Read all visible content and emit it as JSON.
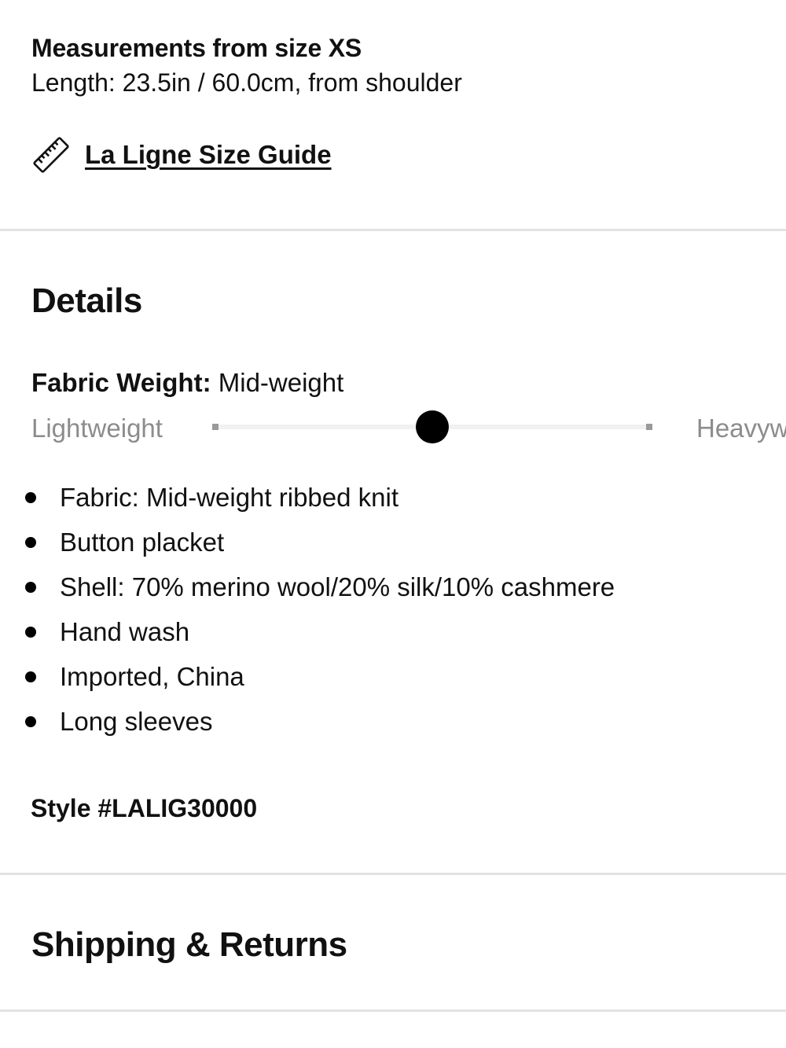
{
  "measurements": {
    "title": "Measurements from size XS",
    "length": "Length: 23.5in / 60.0cm, from shoulder"
  },
  "size_guide": {
    "icon": "ruler-icon",
    "label": "La Ligne Size Guide"
  },
  "details": {
    "heading": "Details",
    "fabric_weight_label": "Fabric Weight:",
    "fabric_weight_value": "Mid-weight",
    "scale_low": "Lightweight",
    "scale_high": "Heavyweight",
    "scale_level": 0.5,
    "items": [
      "Fabric: Mid-weight ribbed knit",
      "Button placket",
      "Shell: 70% merino wool/20% silk/10% cashmere",
      "Hand wash",
      "Imported, China",
      "Long sleeves"
    ],
    "style_number": "Style #LALIG30000"
  },
  "shipping": {
    "heading": "Shipping & Returns"
  },
  "colors": {
    "text": "#111111",
    "muted": "#8c8c8c",
    "divider": "#e3e3e3",
    "thumb": "#000000"
  }
}
